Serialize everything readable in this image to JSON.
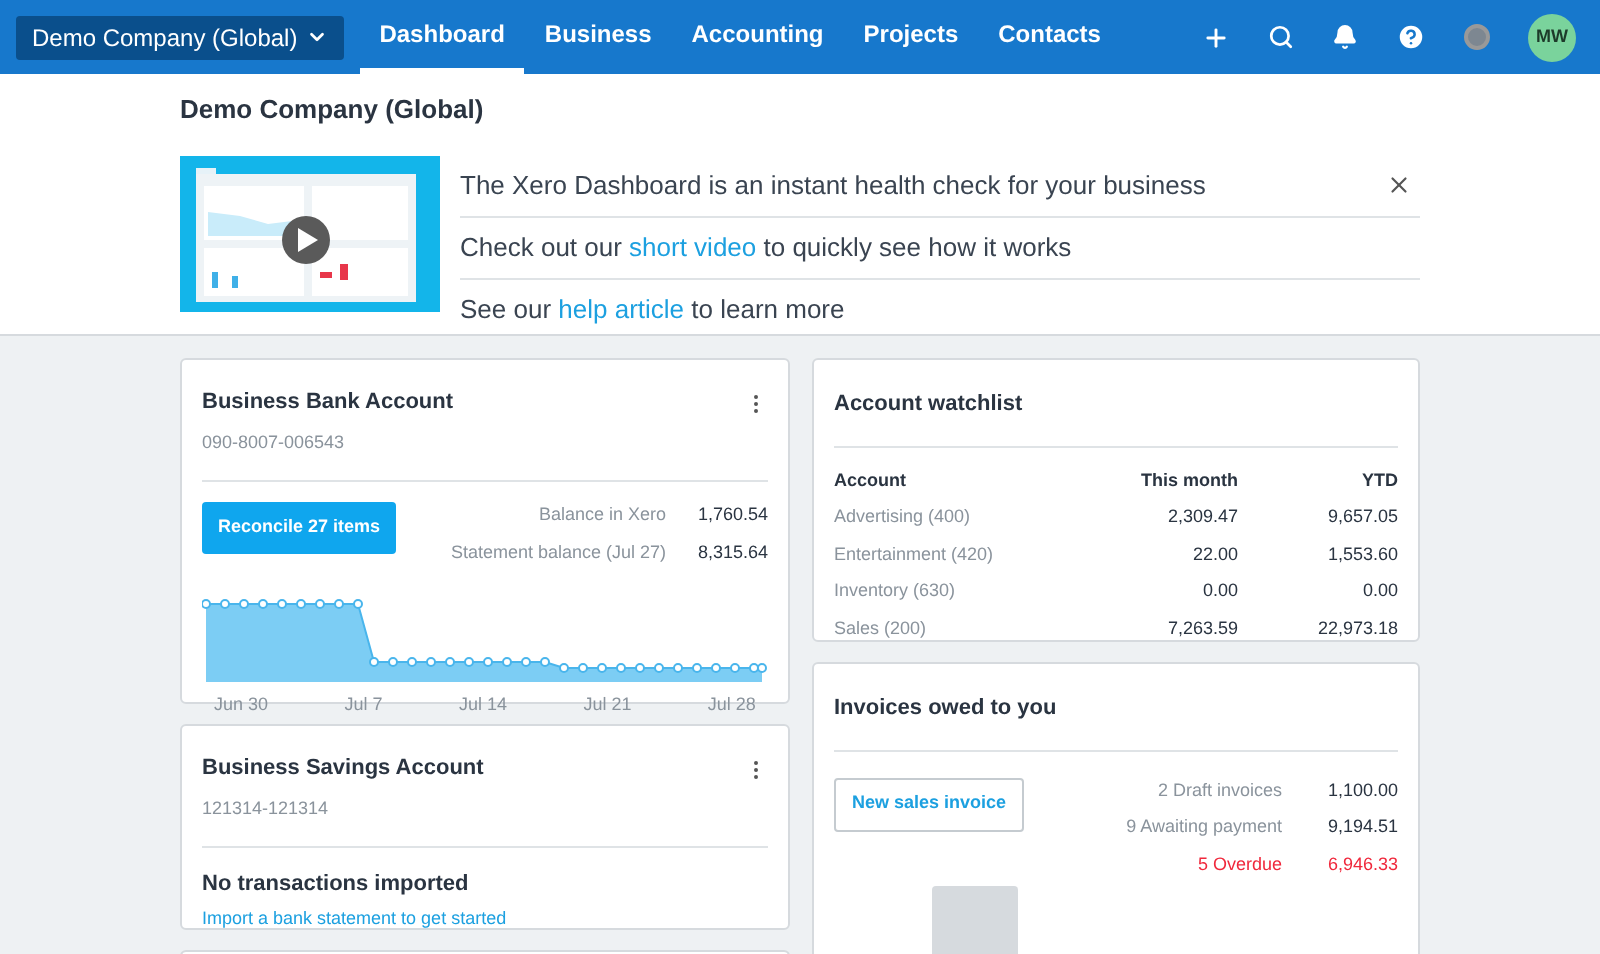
{
  "nav": {
    "org": "Demo Company (Global)",
    "tabs": [
      {
        "label": "Dashboard",
        "selected": true
      },
      {
        "label": "Business",
        "selected": false
      },
      {
        "label": "Accounting",
        "selected": false
      },
      {
        "label": "Projects",
        "selected": false
      },
      {
        "label": "Contacts",
        "selected": false
      }
    ],
    "avatar": "MW"
  },
  "header": {
    "title": "Demo Company (Global)",
    "intro_lines": [
      {
        "before": "The Xero Dashboard is an instant health check for your business"
      },
      {
        "before": "Check out our ",
        "link": "short video",
        "after": " to quickly see how it works"
      },
      {
        "before": "See our ",
        "link": "help article",
        "after": " to learn more"
      }
    ]
  },
  "bank_account": {
    "title": "Business Bank Account",
    "number": "090-8007-006543",
    "button": "Reconcile 27 items",
    "balances": [
      {
        "label": "Balance in Xero",
        "value": "1,760.54"
      },
      {
        "label": "Statement balance (Jul 27)",
        "value": "8,315.64"
      }
    ],
    "chart_labels": [
      "Jun 30",
      "Jul 7",
      "Jul 14",
      "Jul 21",
      "Jul 28"
    ]
  },
  "savings_account": {
    "title": "Business Savings Account",
    "number": "121314-121314",
    "message": "No transactions imported",
    "link": "Import a bank statement to get started"
  },
  "watchlist": {
    "title": "Account watchlist",
    "columns": [
      "Account",
      "This month",
      "YTD"
    ],
    "rows": [
      [
        "Advertising (400)",
        "2,309.47",
        "9,657.05"
      ],
      [
        "Entertainment (420)",
        "22.00",
        "1,553.60"
      ],
      [
        "Inventory (630)",
        "0.00",
        "0.00"
      ],
      [
        "Sales (200)",
        "7,263.59",
        "22,973.18"
      ]
    ]
  },
  "invoices": {
    "title": "Invoices owed to you",
    "button": "New sales invoice",
    "summary": [
      {
        "label": "2 Draft invoices",
        "value": "1,100.00",
        "overdue": false
      },
      {
        "label": "9 Awaiting payment",
        "value": "9,194.51",
        "overdue": false
      },
      {
        "label": "5 Overdue",
        "value": "6,946.33",
        "overdue": true
      }
    ]
  }
}
